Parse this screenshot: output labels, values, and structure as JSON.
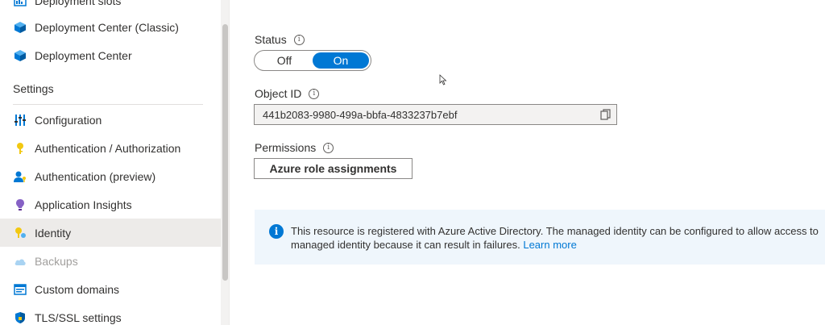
{
  "sidebar": {
    "items_top": [
      {
        "label": "Deployment slots",
        "icon": "deployment-slots-icon"
      },
      {
        "label": "Deployment Center (Classic)",
        "icon": "cube-icon"
      },
      {
        "label": "Deployment Center",
        "icon": "cube-icon"
      }
    ],
    "section_title": "Settings",
    "items": [
      {
        "label": "Configuration",
        "icon": "sliders-icon"
      },
      {
        "label": "Authentication / Authorization",
        "icon": "key-icon"
      },
      {
        "label": "Authentication (preview)",
        "icon": "user-key-icon"
      },
      {
        "label": "Application Insights",
        "icon": "lightbulb-icon"
      },
      {
        "label": "Identity",
        "icon": "identity-key-icon",
        "selected": true
      },
      {
        "label": "Backups",
        "icon": "cloud-icon",
        "disabled": true
      },
      {
        "label": "Custom domains",
        "icon": "domain-icon"
      },
      {
        "label": "TLS/SSL settings",
        "icon": "shield-icon"
      }
    ]
  },
  "status": {
    "label": "Status",
    "off_label": "Off",
    "on_label": "On",
    "value": "On"
  },
  "object_id": {
    "label": "Object ID",
    "value": "441b2083-9980-499a-bbfa-4833237b7ebf"
  },
  "permissions": {
    "label": "Permissions",
    "button_label": "Azure role assignments"
  },
  "banner": {
    "line1": "This resource is registered with Azure Active Directory. The managed identity can be configured to allow access to",
    "line2": "managed identity because it can result in failures.",
    "link": "Learn more"
  },
  "colors": {
    "accent": "#0078d4",
    "banner_bg": "#eff6fc",
    "selected_bg": "#edebe9"
  }
}
